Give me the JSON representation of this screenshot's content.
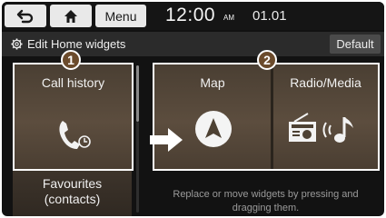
{
  "topbar": {
    "back_icon": "back-arrow-icon",
    "home_icon": "home-icon",
    "menu_label": "Menu",
    "time": "12:00",
    "ampm": "AM",
    "date": "01.01"
  },
  "subbar": {
    "edit_icon": "gear-icon",
    "edit_label": "Edit Home widgets",
    "default_label": "Default"
  },
  "widgets": {
    "call_history": {
      "label": "Call history",
      "icon": "phone-history-icon"
    },
    "map": {
      "label": "Map",
      "icon": "navigation-arrow-icon"
    },
    "radio_media": {
      "label": "Radio/Media",
      "icon": "radio-music-icon"
    },
    "favourites": {
      "line1": "Favourites",
      "line2": "(contacts)"
    }
  },
  "badges": {
    "first": "1",
    "second": "2"
  },
  "hint": "Replace or move widgets by pressing and dragging them.",
  "colors": {
    "widget_bg": "#564838",
    "badge_bg": "#6b4b2c",
    "topbar_bg": "#151515",
    "subbar_bg": "#2b2b2b"
  }
}
